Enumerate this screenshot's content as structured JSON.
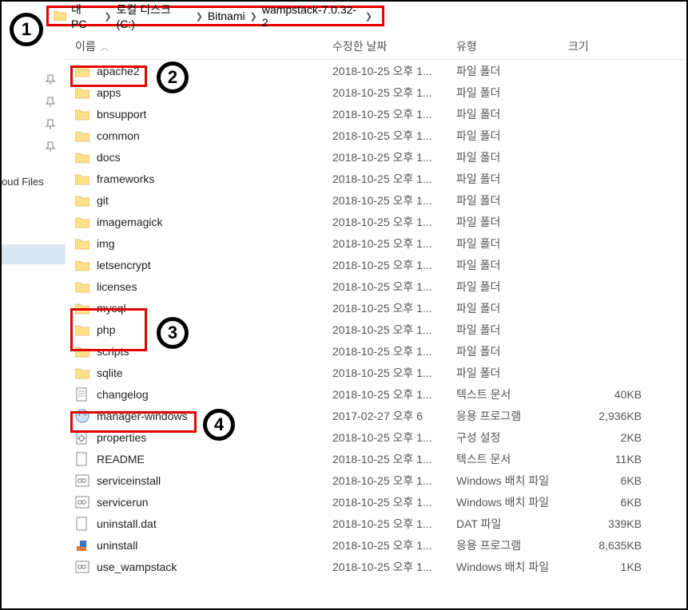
{
  "breadcrumb": {
    "items": [
      "내 PC",
      "로컬 디스크 (C:)",
      "Bitnami",
      "wampstack-7.0.32-2"
    ]
  },
  "sidebar": {
    "cloud_label": "oud Files"
  },
  "columns": {
    "name": "이름",
    "date": "수정한 날짜",
    "type": "유형",
    "size": "크기"
  },
  "file_types": {
    "folder": "파일 폴더",
    "text": "텍스트 문서",
    "app": "응용 프로그램",
    "config": "구성 설정",
    "batch": "Windows 배치 파일",
    "dat": "DAT 파일"
  },
  "items": [
    {
      "icon": "folder",
      "name": "apache2",
      "date": "2018-10-25 오후 1...",
      "type": "folder",
      "size": ""
    },
    {
      "icon": "folder",
      "name": "apps",
      "date": "2018-10-25 오후 1...",
      "type": "folder",
      "size": ""
    },
    {
      "icon": "folder",
      "name": "bnsupport",
      "date": "2018-10-25 오후 1...",
      "type": "folder",
      "size": ""
    },
    {
      "icon": "folder",
      "name": "common",
      "date": "2018-10-25 오후 1...",
      "type": "folder",
      "size": ""
    },
    {
      "icon": "folder",
      "name": "docs",
      "date": "2018-10-25 오후 1...",
      "type": "folder",
      "size": ""
    },
    {
      "icon": "folder",
      "name": "frameworks",
      "date": "2018-10-25 오후 1...",
      "type": "folder",
      "size": ""
    },
    {
      "icon": "folder",
      "name": "git",
      "date": "2018-10-25 오후 1...",
      "type": "folder",
      "size": ""
    },
    {
      "icon": "folder",
      "name": "imagemagick",
      "date": "2018-10-25 오후 1...",
      "type": "folder",
      "size": ""
    },
    {
      "icon": "folder",
      "name": "img",
      "date": "2018-10-25 오후 1...",
      "type": "folder",
      "size": ""
    },
    {
      "icon": "folder",
      "name": "letsencrypt",
      "date": "2018-10-25 오후 1...",
      "type": "folder",
      "size": ""
    },
    {
      "icon": "folder",
      "name": "licenses",
      "date": "2018-10-25 오후 1...",
      "type": "folder",
      "size": ""
    },
    {
      "icon": "folder",
      "name": "mysql",
      "date": "2018-10-25 오후 1...",
      "type": "folder",
      "size": ""
    },
    {
      "icon": "folder",
      "name": "php",
      "date": "2018-10-25 오후 1...",
      "type": "folder",
      "size": ""
    },
    {
      "icon": "folder",
      "name": "scripts",
      "date": "2018-10-25 오후 1...",
      "type": "folder",
      "size": ""
    },
    {
      "icon": "folder",
      "name": "sqlite",
      "date": "2018-10-25 오후 1...",
      "type": "folder",
      "size": ""
    },
    {
      "icon": "text",
      "name": "changelog",
      "date": "2018-10-25 오후 1...",
      "type": "text",
      "size": "40KB"
    },
    {
      "icon": "app",
      "name": "manager-windows",
      "date": "2017-02-27 오후 6",
      "type": "app",
      "size": "2,936KB"
    },
    {
      "icon": "config",
      "name": "properties",
      "date": "2018-10-25 오후 1...",
      "type": "config",
      "size": "2KB"
    },
    {
      "icon": "file",
      "name": "README",
      "date": "2018-10-25 오후 1...",
      "type": "text",
      "size": "11KB"
    },
    {
      "icon": "batch",
      "name": "serviceinstall",
      "date": "2018-10-25 오후 1...",
      "type": "batch",
      "size": "6KB"
    },
    {
      "icon": "batch",
      "name": "servicerun",
      "date": "2018-10-25 오후 1...",
      "type": "batch",
      "size": "6KB"
    },
    {
      "icon": "file",
      "name": "uninstall.dat",
      "date": "2018-10-25 오후 1...",
      "type": "dat",
      "size": "339KB"
    },
    {
      "icon": "uninstall",
      "name": "uninstall",
      "date": "2018-10-25 오후 1...",
      "type": "app",
      "size": "8,635KB"
    },
    {
      "icon": "batch",
      "name": "use_wampstack",
      "date": "2018-10-25 오후 1...",
      "type": "batch",
      "size": "1KB"
    }
  ]
}
